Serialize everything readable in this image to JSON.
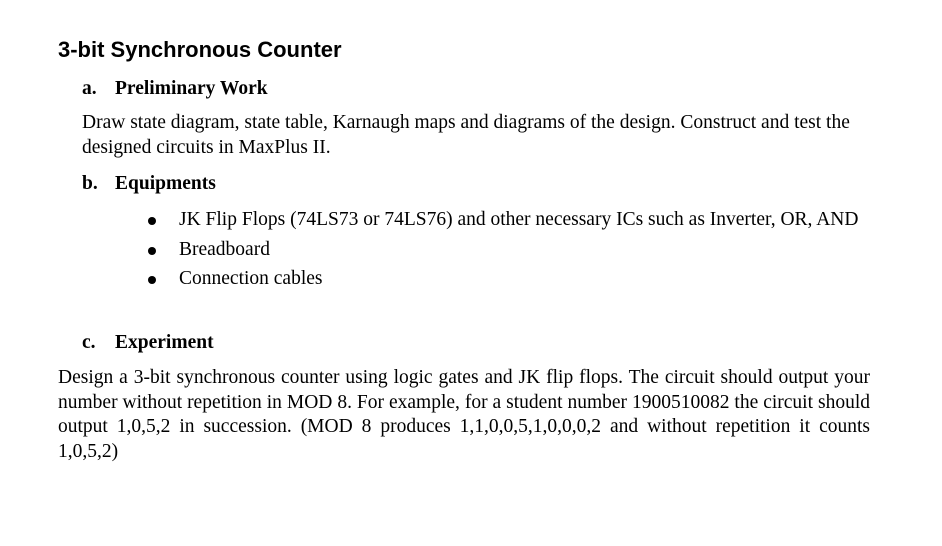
{
  "document": {
    "title": "3-bit Synchronous Counter",
    "sections": [
      {
        "letter": "a.",
        "heading": "Preliminary Work",
        "body": "Draw state diagram, state table, Karnaugh maps and diagrams of the design. Construct and test the designed circuits in MaxPlus II."
      },
      {
        "letter": "b.",
        "heading": "Equipments",
        "bullets": [
          "JK Flip Flops (74LS73 or 74LS76) and other necessary ICs such as Inverter, OR, AND",
          "Breadboard",
          "Connection cables"
        ],
        "bullet_icon": "filled-circle-bullet"
      },
      {
        "letter": "c.",
        "heading": "Experiment",
        "body": "Design a 3-bit synchronous counter using logic gates and JK flip flops. The circuit should output your number without repetition in MOD 8. For example, for a student number 1900510082 the circuit should output 1,0,5,2 in succession. (MOD 8 produces 1,1,0,0,5,1,0,0,0,2 and without repetition it counts 1,0,5,2)"
      }
    ]
  }
}
